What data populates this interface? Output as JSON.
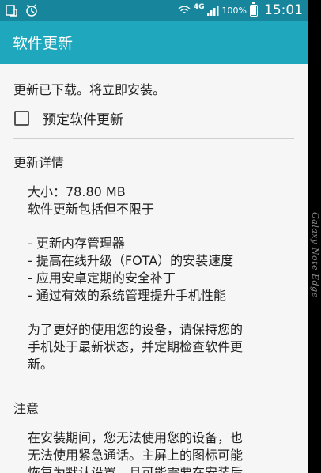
{
  "status_bar": {
    "network_type": "4G",
    "battery_percent": "100%",
    "time": "15:01",
    "battery_level": 1.0
  },
  "app_bar": {
    "title": "软件更新"
  },
  "main": {
    "intro_text": "更新已下载。将立即安装。",
    "schedule_checkbox": {
      "label": "预定软件更新",
      "checked": false
    },
    "details_section": {
      "title": "更新详情",
      "size_line": "大小：78.80 MB",
      "includes_line": "软件更新包括但不限于",
      "items": [
        "- 更新内存管理器",
        "- 提高在线升级（FOTA）的安装速度",
        "- 应用安卓定期的安全补丁",
        "- 通过有效的系统管理提升手机性能"
      ],
      "advice_line1": "为了更好的使用您的设备，请保持您的",
      "advice_line2": "手机处于最新状态，并定期检查软件更",
      "advice_line3": "新。"
    },
    "note_section": {
      "title": "注意",
      "line1": "在安装期间，您无法使用您的设备，也",
      "line2": "无法使用紧急通话。主屏上的图标可能",
      "line3": "恢复为默认设置，且可能需要在安装后"
    }
  },
  "edge_label": "Galaxy Note Edge",
  "colors": {
    "status_bar_bg": "#17869d",
    "app_bar_bg": "#1fa7bd",
    "content_bg": "#f6f6f6"
  }
}
